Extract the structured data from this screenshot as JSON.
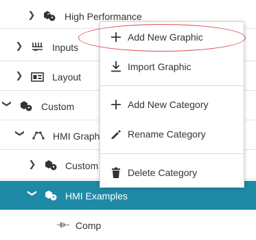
{
  "tree": {
    "high_performance": "High Performance",
    "inputs": "Inputs",
    "layout": "Layout",
    "custom": "Custom",
    "hmi_graphics": "HMI Graph",
    "custom_sub": "Custom",
    "hmi_examples": "HMI Examples",
    "comp": "Comp"
  },
  "context_menu": {
    "add_new_graphic": "Add New Graphic",
    "import_graphic": "Import Graphic",
    "add_new_category": "Add New Category",
    "rename_category": "Rename Category",
    "delete_category": "Delete Category"
  },
  "colors": {
    "selected_row": "#1f8aa6",
    "annotation_ellipse": "#d94c4c"
  }
}
